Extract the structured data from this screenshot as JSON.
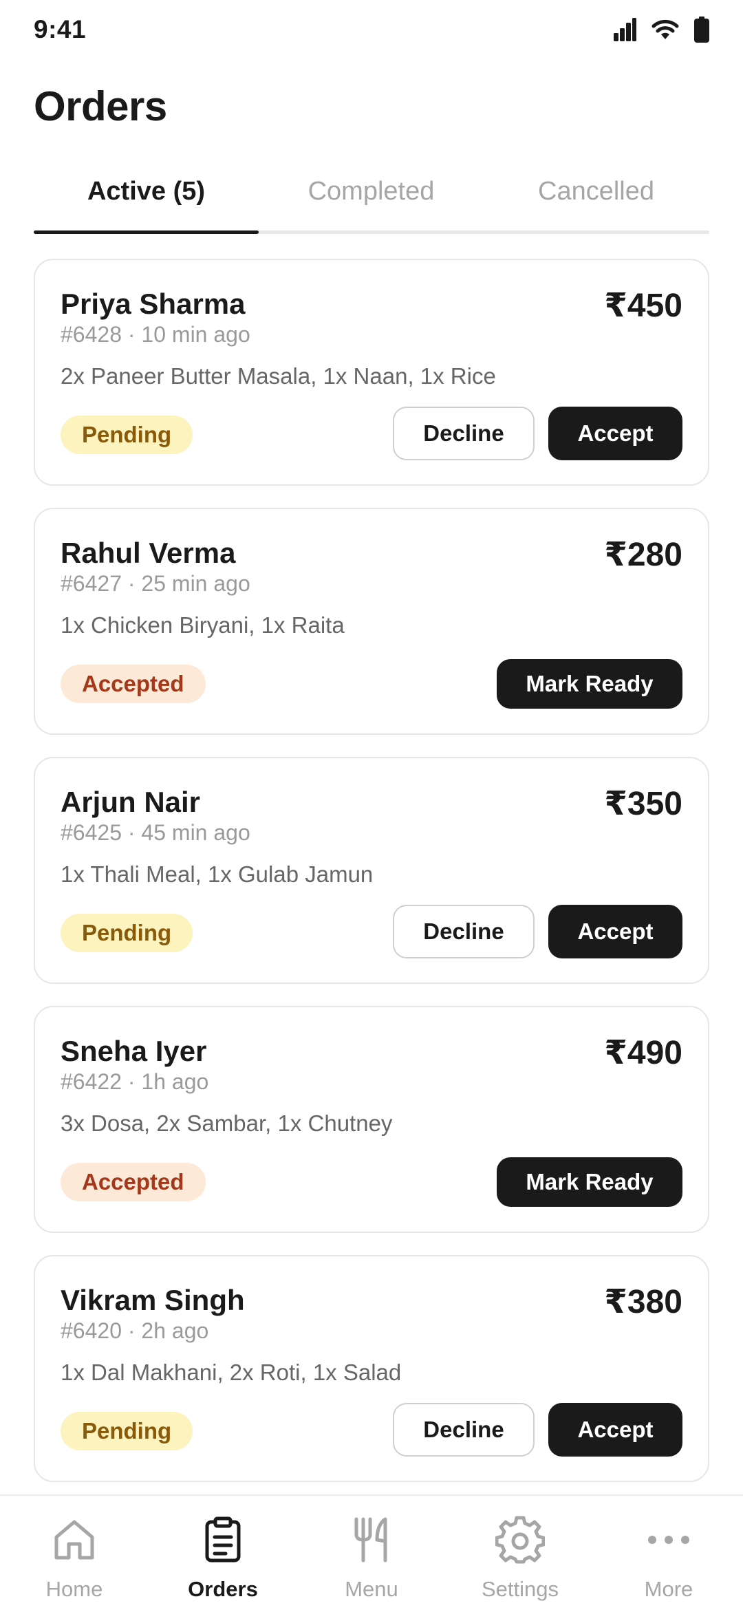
{
  "status_bar": {
    "time": "9:41"
  },
  "page": {
    "title": "Orders"
  },
  "tabs": [
    {
      "label": "Active (5)",
      "active": true
    },
    {
      "label": "Completed",
      "active": false
    },
    {
      "label": "Cancelled",
      "active": false
    }
  ],
  "orders": [
    {
      "name": "Priya Sharma",
      "price": "₹450",
      "meta": "#6428 · 10 min ago",
      "items": "2x Paneer Butter Masala, 1x Naan, 1x Rice",
      "status": "Pending",
      "decline_label": "Decline",
      "accept_label": "Accept"
    },
    {
      "name": "Rahul Verma",
      "price": "₹280",
      "meta": "#6427 · 25 min ago",
      "items": "1x Chicken Biryani, 1x Raita",
      "status": "Accepted",
      "mark_ready_label": "Mark Ready"
    },
    {
      "name": "Arjun Nair",
      "price": "₹350",
      "meta": "#6425 · 45 min ago",
      "items": "1x Thali Meal, 1x Gulab Jamun",
      "status": "Pending",
      "decline_label": "Decline",
      "accept_label": "Accept"
    },
    {
      "name": "Sneha Iyer",
      "price": "₹490",
      "meta": "#6422 · 1h ago",
      "items": "3x Dosa, 2x Sambar, 1x Chutney",
      "status": "Accepted",
      "mark_ready_label": "Mark Ready"
    },
    {
      "name": "Vikram Singh",
      "price": "₹380",
      "meta": "#6420 · 2h ago",
      "items": "1x Dal Makhani, 2x Roti, 1x Salad",
      "status": "Pending",
      "decline_label": "Decline",
      "accept_label": "Accept"
    }
  ],
  "bottom_nav": [
    {
      "label": "Home",
      "icon": "home-icon",
      "active": false
    },
    {
      "label": "Orders",
      "icon": "clipboard-icon",
      "active": true
    },
    {
      "label": "Menu",
      "icon": "fork-knife-icon",
      "active": false
    },
    {
      "label": "Settings",
      "icon": "gear-icon",
      "active": false
    },
    {
      "label": "More",
      "icon": "more-dots-icon",
      "active": false
    }
  ],
  "colors": {
    "primary": "#1a1a1a",
    "pending_bg": "#fcf3be",
    "pending_text": "#8a5a0b",
    "accepted_bg": "#fde9d8",
    "accepted_text": "#a3381a",
    "muted": "#a6a6a6"
  }
}
